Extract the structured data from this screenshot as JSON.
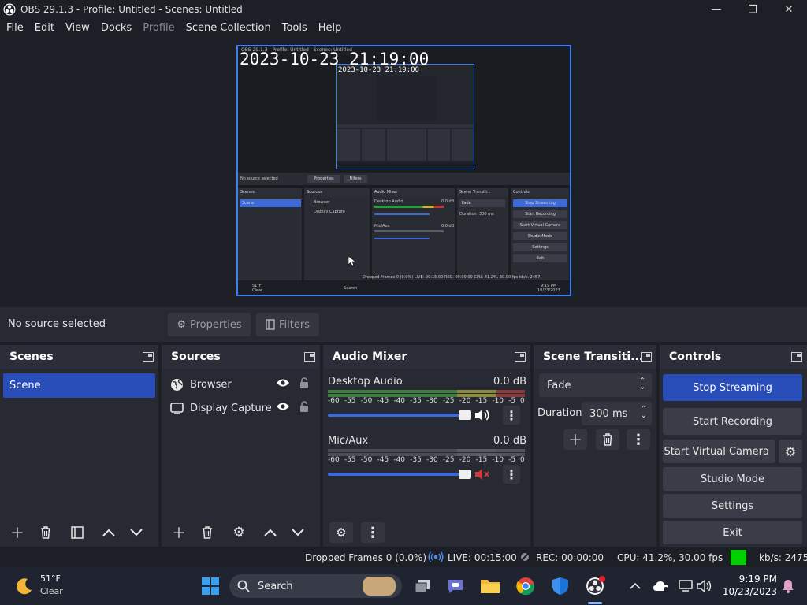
{
  "window": {
    "title": "OBS 29.1.3 - Profile: Untitled - Scenes: Untitled",
    "minimize_glyph": "—",
    "maximize_glyph": "❐",
    "close_glyph": "✕"
  },
  "menu": [
    "File",
    "Edit",
    "View",
    "Docks",
    "Profile",
    "Scene Collection",
    "Tools",
    "Help"
  ],
  "preview": {
    "clock_text": "2023-10-23 21:19:00",
    "inner_clock_text": "2023-10-23 21:19:00",
    "window_title": "OBS 29.1.3 - Profile: Untitled - Scenes: Untitled",
    "no_source": "No source selected",
    "properties": "Properties",
    "filters": "Filters",
    "scenes": "Scenes",
    "scene": "Scene",
    "sources": "Sources",
    "browser": "Browser",
    "display_capture": "Display Capture",
    "audio_mixer": "Audio Mixer",
    "desktop_audio": "Desktop Audio",
    "mic_aux": "Mic/Aux",
    "db": "0.0 dB",
    "scene_transitions": "Scene Transiti...",
    "fade": "Fade",
    "duration": "Duration",
    "duration_value": "300 ms",
    "controls": "Controls",
    "stop_streaming": "Stop Streaming",
    "start_recording": "Start Recording",
    "start_virtual_camera": "Start Virtual Camera",
    "studio_mode": "Studio Mode",
    "settings": "Settings",
    "exit": "Exit",
    "status_text": "Dropped Frames 0 (0.0%)  LIVE: 00:15:00  REC: 00:00:00  CPU: 41.2%, 30.00 fps  kb/s: 2457",
    "search": "Search",
    "weather_temp": "51°F",
    "weather_cond": "Clear",
    "tray_time": "9:19 PM",
    "tray_date": "10/23/2023"
  },
  "source_toolbar": {
    "no_source": "No source selected",
    "properties_label": "Properties",
    "filters_label": "Filters"
  },
  "scenes": {
    "title": "Scenes",
    "items": [
      "Scene"
    ]
  },
  "sources": {
    "title": "Sources",
    "items": [
      {
        "label": "Browser",
        "icon": "globe-icon"
      },
      {
        "label": "Display Capture",
        "icon": "monitor-icon"
      }
    ]
  },
  "audio_mixer": {
    "title": "Audio Mixer",
    "channels": [
      {
        "name": "Desktop Audio",
        "db": "0.0 dB",
        "volume_fraction": 0.96,
        "muted": false
      },
      {
        "name": "Mic/Aux",
        "db": "0.0 dB",
        "volume_fraction": 0.96,
        "muted": true
      }
    ],
    "scale": [
      "-60",
      "-55",
      "-50",
      "-45",
      "-40",
      "-35",
      "-30",
      "-25",
      "-20",
      "-15",
      "-10",
      "-5",
      "0"
    ]
  },
  "transitions": {
    "title": "Scene Transiti...",
    "selected": "Fade",
    "duration_label": "Duration",
    "duration_value": "300 ms"
  },
  "controls": {
    "title": "Controls",
    "stop_streaming": "Stop Streaming",
    "start_recording": "Start Recording",
    "start_virtual_camera": "Start Virtual Camera",
    "studio_mode": "Studio Mode",
    "settings": "Settings",
    "exit": "Exit"
  },
  "status": {
    "dropped_frames": "Dropped Frames 0 (0.0%)",
    "live": "LIVE: 00:15:00",
    "rec": "REC: 00:00:00",
    "cpu": "CPU: 41.2%, 30.00 fps",
    "kbps": "kb/s: 2475",
    "indicator_color": "#00d000"
  },
  "taskbar": {
    "weather_temp": "51°F",
    "weather_cond": "Clear",
    "search_placeholder": "Search",
    "time": "9:19 PM",
    "date": "10/23/2023"
  },
  "colors": {
    "accent": "#284cb8",
    "preview_border": "#3d7ff1",
    "dock_bg": "#272a33",
    "window_bg": "#1d1f26",
    "mute_red": "#d0393e"
  }
}
